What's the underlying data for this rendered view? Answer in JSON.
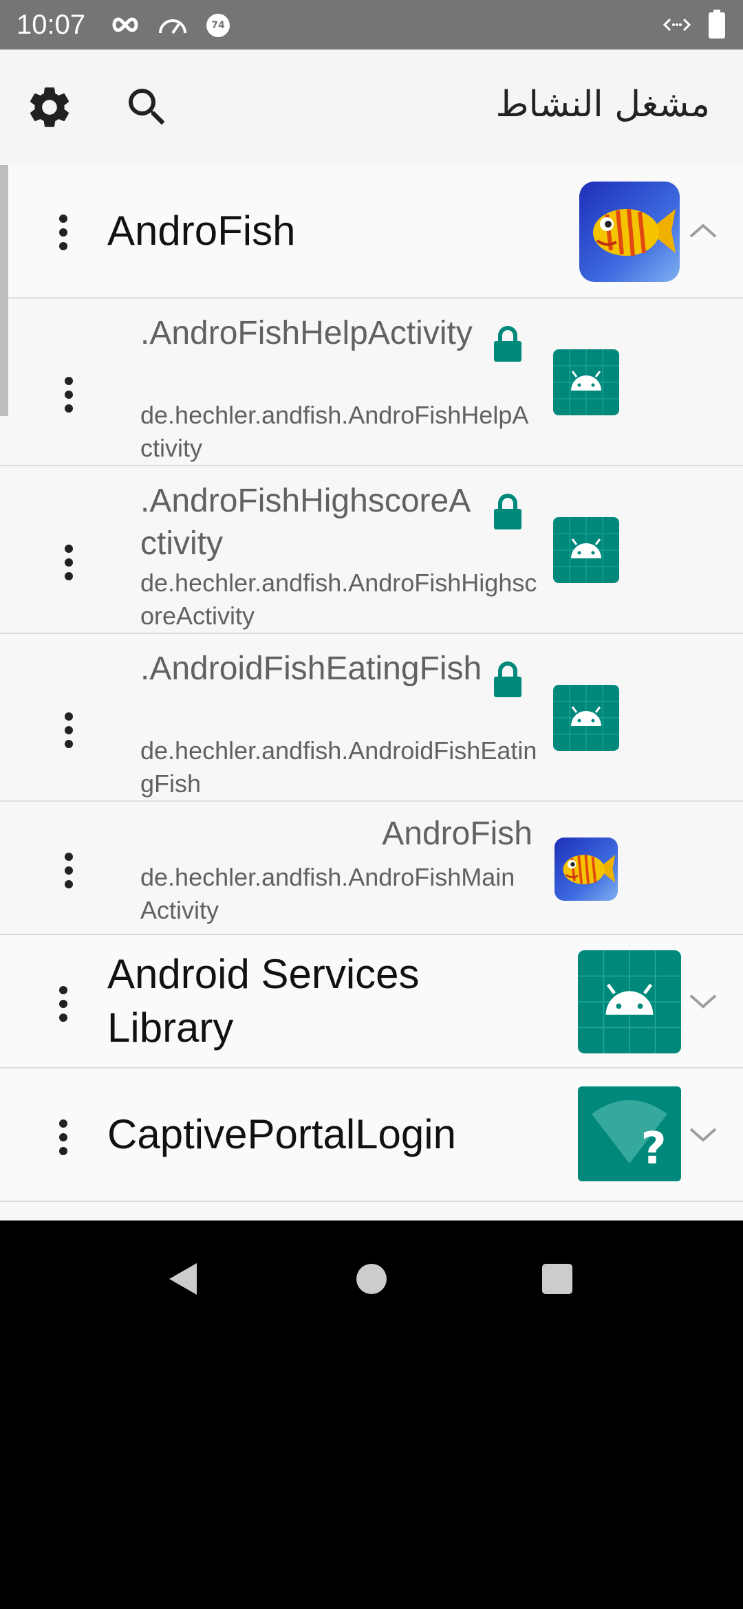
{
  "status_bar": {
    "time": "10:07",
    "icons_left": [
      "infinity-icon",
      "speedometer-icon",
      "notification-count-icon"
    ],
    "notification_count": "74",
    "icons_right": [
      "data-transfer-icon",
      "battery-icon"
    ]
  },
  "app_bar": {
    "title": "مشغل النشاط",
    "actions": [
      "settings-icon",
      "search-icon"
    ]
  },
  "colors": {
    "accent": "#00897B",
    "status_bar_bg": "#757575",
    "app_bar_bg": "#F5F5F5",
    "list_bg": "#F7F7F7"
  },
  "list": {
    "groups": [
      {
        "title": "AndroFish",
        "expanded": true,
        "activities": [
          {
            "name": ".AndroFishHelpActivity",
            "package": "de.hechler.andfish.AndroFishHelpActivity",
            "locked": true
          },
          {
            "name": ".AndroFishHighscoreActivity",
            "package": "de.hechler.andfish.AndroFishHighscoreActivity",
            "locked": true
          },
          {
            "name": ".AndroidFishEatingFish",
            "package": "de.hechler.andfish.AndroidFishEatingFish",
            "locked": true
          },
          {
            "name": "AndroFish",
            "package": "de.hechler.andfish.AndroFishMainActivity",
            "locked": false
          }
        ]
      },
      {
        "title": "Android Services Library",
        "expanded": false
      },
      {
        "title": "CaptivePortalLogin",
        "expanded": false
      }
    ]
  },
  "nav": {
    "buttons": [
      "back-icon",
      "home-icon",
      "recents-icon"
    ]
  }
}
